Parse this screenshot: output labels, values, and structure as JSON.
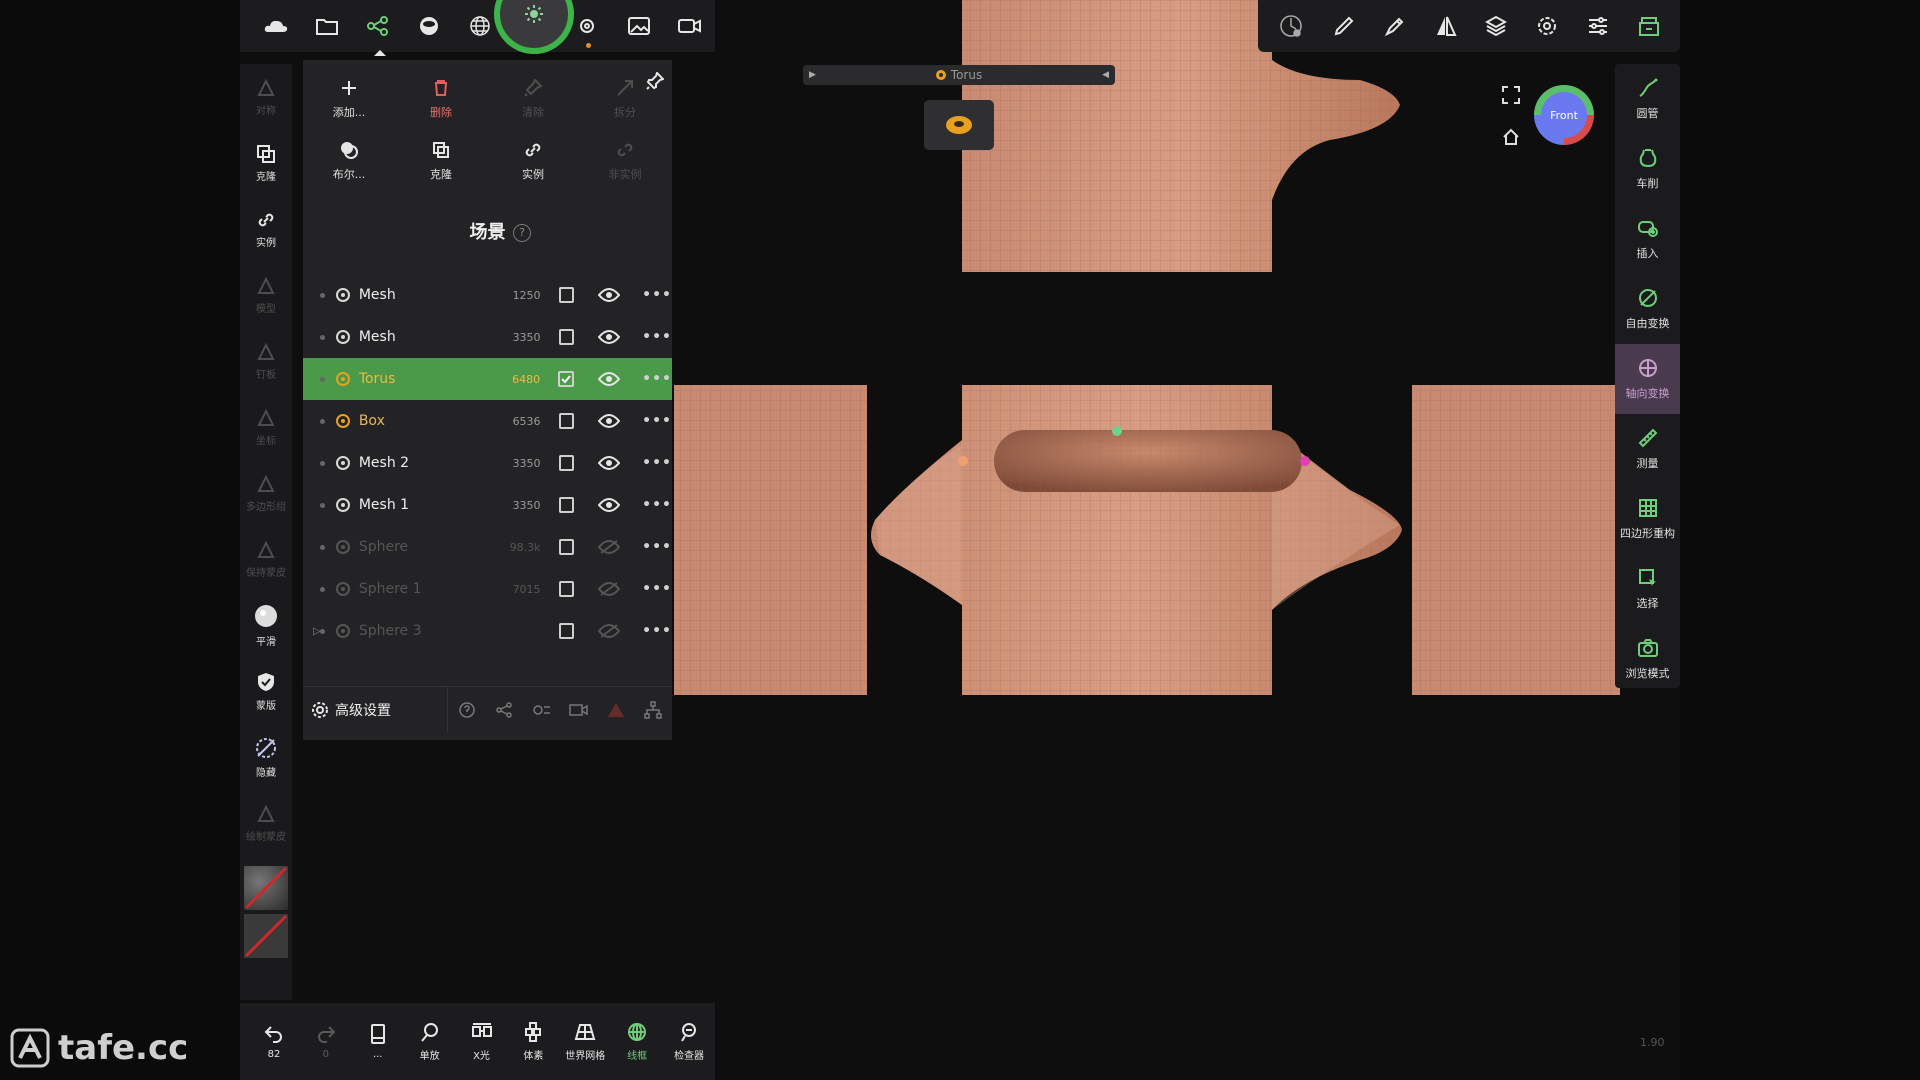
{
  "colors": {
    "accent_green": "#4a9a4a",
    "selected_text": "#e8bd3a",
    "skin": "#c98a6d",
    "view_cube": "#6b79f0"
  },
  "top_toolbar_left": {
    "icons": [
      "cloud-icon",
      "folder-icon",
      "scene-graph-icon",
      "material-ball-icon",
      "wireframe-sphere-icon",
      "light-icon",
      "settings-gear-icon",
      "image-icon",
      "video-camera-icon"
    ]
  },
  "top_toolbar_right": {
    "icons": [
      "gizmo-icon",
      "brush-icon",
      "pen-icon",
      "symmetry-icon",
      "layers-icon",
      "settings-icon",
      "sliders-icon",
      "shop-icon"
    ]
  },
  "left_tools": [
    {
      "label": "对称",
      "dim": true
    },
    {
      "label": "克隆",
      "dim": false
    },
    {
      "label": "实例",
      "dim": false
    },
    {
      "label": "模型",
      "dim": true
    },
    {
      "label": "钉板",
      "dim": true
    },
    {
      "label": "坐标",
      "dim": true
    },
    {
      "label": "多边形组",
      "dim": true
    },
    {
      "label": "保持蒙皮",
      "dim": true
    },
    {
      "label": "平滑",
      "dim": false
    },
    {
      "label": "蒙版",
      "dim": false
    },
    {
      "label": "隐藏",
      "dim": false
    },
    {
      "label": "绘制蒙皮",
      "dim": true
    }
  ],
  "scene_panel": {
    "tools": [
      {
        "label": "添加...",
        "state": "normal"
      },
      {
        "label": "删除",
        "state": "delete"
      },
      {
        "label": "清除",
        "state": "dim"
      },
      {
        "label": "拆分",
        "state": "dim"
      },
      {
        "label": "布尔...",
        "state": "normal"
      },
      {
        "label": "克隆",
        "state": "normal"
      },
      {
        "label": "实例",
        "state": "normal"
      },
      {
        "label": "非实例",
        "state": "dim"
      }
    ],
    "title": "场景",
    "help": "?",
    "rows": [
      {
        "name": "Mesh",
        "count": "1250",
        "state": "normal",
        "checked": false,
        "visible": true
      },
      {
        "name": "Mesh",
        "count": "3350",
        "state": "normal",
        "checked": false,
        "visible": true
      },
      {
        "name": "Torus",
        "count": "6480",
        "state": "selected",
        "checked": true,
        "visible": true
      },
      {
        "name": "Box",
        "count": "6536",
        "state": "box",
        "checked": false,
        "visible": true
      },
      {
        "name": "Mesh 2",
        "count": "3350",
        "state": "normal",
        "checked": false,
        "visible": true
      },
      {
        "name": "Mesh 1",
        "count": "3350",
        "state": "normal",
        "checked": false,
        "visible": true
      },
      {
        "name": "Sphere",
        "count": "98.3k",
        "state": "hidden",
        "checked": false,
        "visible": false
      },
      {
        "name": "Sphere 1",
        "count": "7015",
        "state": "hidden",
        "checked": false,
        "visible": false
      },
      {
        "name": "Sphere 3",
        "count": "",
        "state": "hidden",
        "checked": false,
        "visible": false
      }
    ],
    "advanced_label": "高级设置"
  },
  "viewport": {
    "object_label": "Torus",
    "view_cube_label": "Front",
    "zoom": "1.90"
  },
  "right_tools": [
    {
      "label": "圆管",
      "icon": "tube-icon",
      "active": false
    },
    {
      "label": "车削",
      "icon": "lathe-icon",
      "active": false
    },
    {
      "label": "插入",
      "icon": "insert-icon",
      "active": false
    },
    {
      "label": "自由变换",
      "icon": "free-transform-icon",
      "active": false
    },
    {
      "label": "轴向变换",
      "icon": "axial-transform-icon",
      "active": true
    },
    {
      "label": "测量",
      "icon": "ruler-icon",
      "active": false
    },
    {
      "label": "四边形重构",
      "icon": "quad-remesh-icon",
      "active": false
    },
    {
      "label": "选择",
      "icon": "select-icon",
      "active": false
    },
    {
      "label": "浏览模式",
      "icon": "camera-icon",
      "active": false
    }
  ],
  "bottom_toolbar": [
    {
      "label": "82",
      "icon": "undo-icon",
      "state": "normal"
    },
    {
      "label": "0",
      "icon": "redo-icon",
      "state": "dim"
    },
    {
      "label": "...",
      "icon": "device-icon",
      "state": "normal"
    },
    {
      "label": "单放",
      "icon": "zoom-icon",
      "state": "normal"
    },
    {
      "label": "X光",
      "icon": "xray-icon",
      "state": "normal"
    },
    {
      "label": "体素",
      "icon": "voxel-icon",
      "state": "normal"
    },
    {
      "label": "世界网格",
      "icon": "world-grid-icon",
      "state": "normal"
    },
    {
      "label": "线框",
      "icon": "wireframe-icon",
      "state": "active"
    },
    {
      "label": "检查器",
      "icon": "inspector-icon",
      "state": "normal"
    }
  ],
  "watermark": "tafe.cc"
}
